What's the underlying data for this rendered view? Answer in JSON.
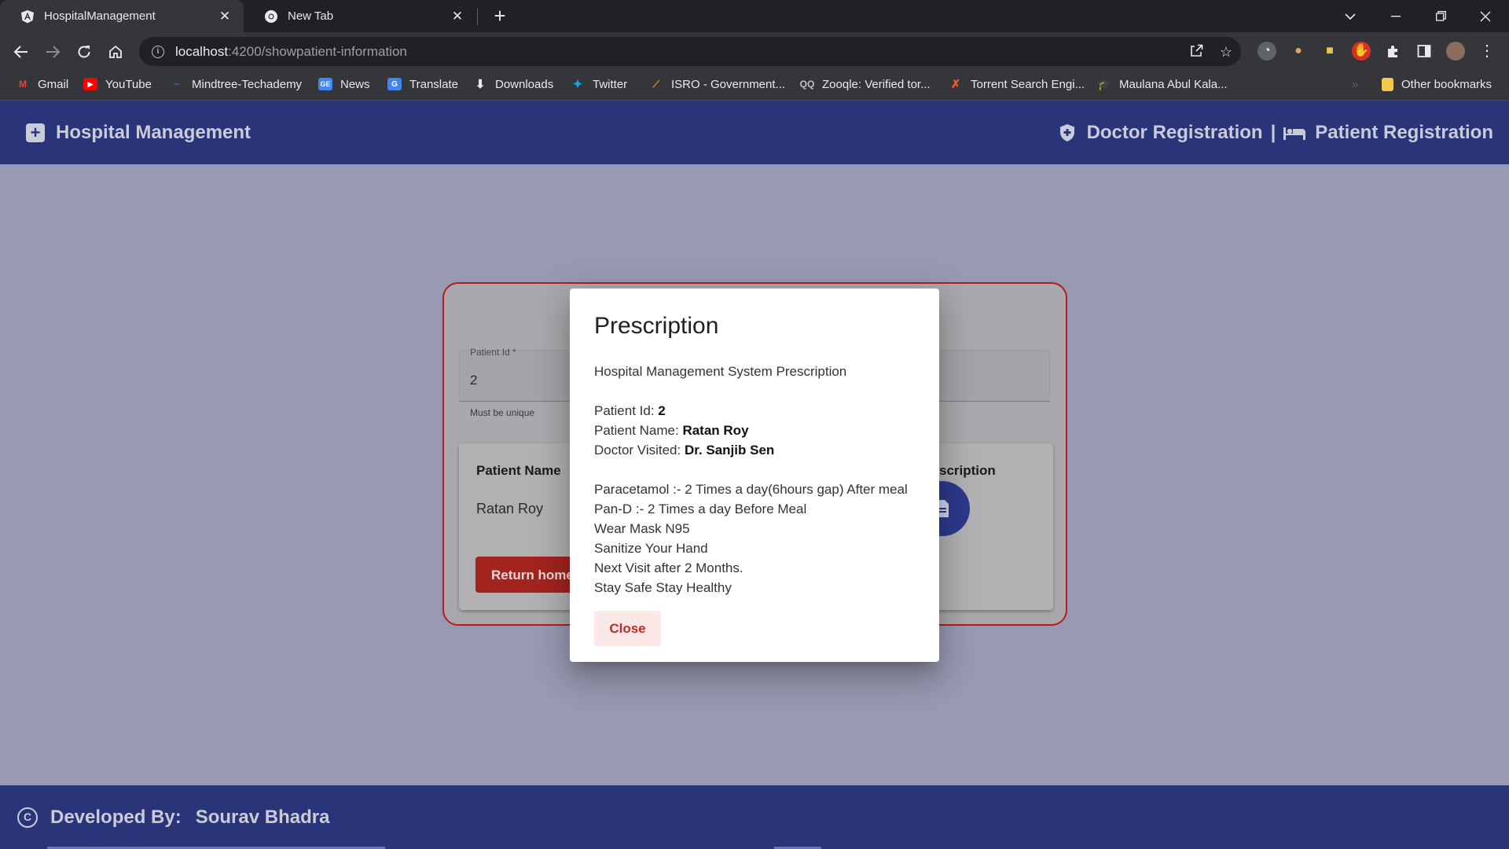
{
  "browser": {
    "tabs": [
      {
        "title": "HospitalManagement",
        "icon": "angular-icon",
        "active": true
      },
      {
        "title": "New Tab",
        "icon": "chrome-icon",
        "active": false
      }
    ],
    "close_glyph": "✕",
    "new_tab_glyph": "+",
    "url_host": "localhost",
    "url_path": ":4200/showpatient-information",
    "bookmarks": [
      {
        "label": "Gmail",
        "icon": "gmail-icon",
        "color": "#ea4335"
      },
      {
        "label": "YouTube",
        "icon": "youtube-icon",
        "color": "#ff0000"
      },
      {
        "label": "Mindtree-Techademy",
        "icon": "mindtree-icon",
        "color": "#1a73e8"
      },
      {
        "label": "News",
        "icon": "google-news-icon",
        "color": "#4285f4"
      },
      {
        "label": "Translate",
        "icon": "google-translate-icon",
        "color": "#4285f4"
      },
      {
        "label": "Downloads",
        "icon": "download-icon",
        "color": "#e8eaed"
      },
      {
        "label": "Twitter",
        "icon": "twitter-icon",
        "color": "#1da1f2"
      },
      {
        "label": "ISRO - Government...",
        "icon": "isro-icon",
        "color": "#f28b30"
      },
      {
        "label": "Zooqle: Verified tor...",
        "icon": "zooqle-icon",
        "color": "#bdc1c6"
      },
      {
        "label": "Torrent Search Engi...",
        "icon": "torrent-icon",
        "color": "#ff5722"
      },
      {
        "label": "Maulana Abul Kala...",
        "icon": "graduation-cap-icon",
        "color": "#9aa0a6"
      }
    ],
    "other_bookmarks": "Other bookmarks"
  },
  "header": {
    "brand": "Hospital Management",
    "nav": {
      "doctor": "Doctor Registration",
      "separator": "|",
      "patient": "Patient Registration"
    }
  },
  "form": {
    "patient_id_label": "Patient Id *",
    "patient_id_value": "2",
    "patient_id_hint": "Must be unique"
  },
  "table": {
    "col_patient_name": "Patient Name",
    "col_prescription": "scription",
    "patient_name": "Ratan Roy",
    "return_button": "Return home"
  },
  "dialog": {
    "title": "Prescription",
    "subtitle": "Hospital Management System Prescription",
    "fields": [
      {
        "label": "Patient Id: ",
        "value": "2"
      },
      {
        "label": "Patient Name: ",
        "value": "Ratan Roy"
      },
      {
        "label": "Doctor Visited: ",
        "value": "Dr. Sanjib Sen"
      }
    ],
    "instructions": [
      "Paracetamol :- 2 Times a day(6hours gap) After meal",
      "Pan-D :- 2 Times a day Before Meal",
      "Wear Mask N95",
      "Sanitize Your Hand",
      "Next Visit after 2 Months.",
      "Stay Safe Stay Healthy"
    ],
    "close_button": "Close"
  },
  "footer": {
    "copyright_glyph": "C",
    "developed_by": "Developed By:",
    "developer": "Sourav Bhadra"
  },
  "colors": {
    "header_bg": "#293479",
    "overlay_bg": "#979ab2",
    "danger": "#c62828"
  }
}
